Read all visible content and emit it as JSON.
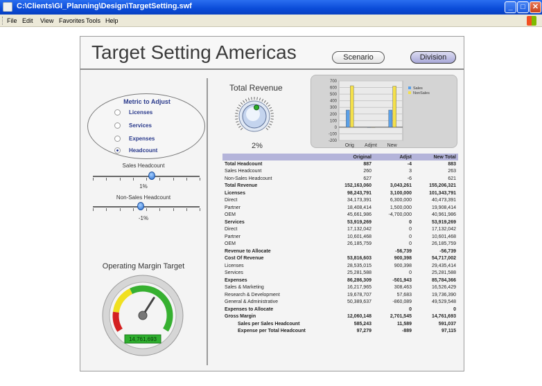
{
  "window": {
    "title": "C:\\Clients\\GI_Planning\\Design\\TargetSetting.swf",
    "menu": [
      "File",
      "Edit",
      "View",
      "Favorites",
      "Tools",
      "Help"
    ]
  },
  "app": {
    "title": "Target Setting Americas",
    "scenario_label": "Scenario",
    "division_label": "Division"
  },
  "metric": {
    "title": "Metric to Adjust",
    "options": [
      {
        "label": "Licenses",
        "selected": false
      },
      {
        "label": "Services",
        "selected": false
      },
      {
        "label": "Expenses",
        "selected": false
      },
      {
        "label": "Headcount",
        "selected": true
      }
    ]
  },
  "sliders": [
    {
      "label": "Sales Headcount",
      "value_label": "1%",
      "position": 0.55
    },
    {
      "label": "Non-Sales Headcount",
      "value_label": "-1%",
      "position": 0.45
    }
  ],
  "revenue": {
    "title": "Total Revenue",
    "percent": "2%",
    "knob_position": 0.55
  },
  "operating_margin": {
    "title": "Operating Margin Target",
    "value": "14,761,693",
    "needle_position": 0.62
  },
  "chart_data": {
    "type": "bar",
    "categories": [
      "Orig",
      "Adjmt",
      "New"
    ],
    "series": [
      {
        "name": "Sales",
        "values": [
          260,
          0,
          260
        ],
        "color": "#5aa0e8"
      },
      {
        "name": "NonSales",
        "values": [
          627,
          0,
          621
        ],
        "color": "#f4e04a"
      }
    ],
    "yticks": [
      "700",
      "600",
      "500",
      "400",
      "300",
      "200",
      "100",
      "0",
      "-100",
      "-200"
    ],
    "ylim": [
      -200,
      700
    ]
  },
  "table": {
    "headers": [
      "",
      "Original",
      "Adjst",
      "New Total"
    ],
    "rows": [
      {
        "label": "Total Headcount",
        "orig": "887",
        "adj": "-4",
        "new": "883",
        "style": "bold"
      },
      {
        "label": "Sales Headcount",
        "orig": "260",
        "adj": "3",
        "new": "263",
        "style": ""
      },
      {
        "label": "Non-Sales Headcount",
        "orig": "627",
        "adj": "-6",
        "new": "621",
        "style": ""
      },
      {
        "label": "Total Revenue",
        "orig": "152,163,060",
        "adj": "3,043,261",
        "new": "155,206,321",
        "style": "bold"
      },
      {
        "label": "Licenses",
        "orig": "98,243,791",
        "adj": "3,100,000",
        "new": "101,343,791",
        "style": "bold"
      },
      {
        "label": "Direct",
        "orig": "34,173,391",
        "adj": "6,300,000",
        "new": "40,473,391",
        "style": ""
      },
      {
        "label": "Partner",
        "orig": "18,408,414",
        "adj": "1,500,000",
        "new": "19,908,414",
        "style": ""
      },
      {
        "label": "OEM",
        "orig": "45,661,986",
        "adj": "-4,700,000",
        "new": "40,961,986",
        "style": ""
      },
      {
        "label": "Services",
        "orig": "53,919,269",
        "adj": "0",
        "new": "53,919,269",
        "style": "bold"
      },
      {
        "label": "Direct",
        "orig": "17,132,042",
        "adj": "0",
        "new": "17,132,042",
        "style": ""
      },
      {
        "label": "Partner",
        "orig": "10,601,468",
        "adj": "0",
        "new": "10,601,468",
        "style": ""
      },
      {
        "label": "OEM",
        "orig": "26,185,759",
        "adj": "0",
        "new": "26,185,759",
        "style": ""
      },
      {
        "label": "Revenue to Allocate",
        "orig": "",
        "adj": "-56,739",
        "new": "-56,739",
        "style": "bold"
      },
      {
        "label": "Cost Of Revenue",
        "orig": "53,816,603",
        "adj": "900,398",
        "new": "54,717,002",
        "style": "bold"
      },
      {
        "label": "Licenses",
        "orig": "28,535,015",
        "adj": "900,398",
        "new": "29,435,414",
        "style": ""
      },
      {
        "label": "Services",
        "orig": "25,281,588",
        "adj": "0",
        "new": "25,281,588",
        "style": ""
      },
      {
        "label": "Expenses",
        "orig": "86,286,309",
        "adj": "-501,943",
        "new": "85,784,366",
        "style": "bold"
      },
      {
        "label": "Sales & Marketing",
        "orig": "16,217,965",
        "adj": "308,463",
        "new": "16,526,429",
        "style": ""
      },
      {
        "label": "Research & Development",
        "orig": "19,678,707",
        "adj": "57,683",
        "new": "19,736,390",
        "style": ""
      },
      {
        "label": "General & Administrative",
        "orig": "50,389,637",
        "adj": "-860,089",
        "new": "49,529,548",
        "style": ""
      },
      {
        "label": "Expenses to Allocate",
        "orig": "",
        "adj": "0",
        "new": "0",
        "style": "bold"
      },
      {
        "label": "Gross Margin",
        "orig": "12,060,148",
        "adj": "2,701,545",
        "new": "14,761,693",
        "style": "bold"
      },
      {
        "label": "Sales per Sales Headcount",
        "orig": "585,243",
        "adj": "11,589",
        "new": "591,037",
        "style": "bold indent"
      },
      {
        "label": "Expense per Total Headcount",
        "orig": "97,279",
        "adj": "-889",
        "new": "97,115",
        "style": "bold indent"
      }
    ]
  },
  "colors": {
    "titlebar": "#0a4bd8",
    "accent": "#2a3a8c",
    "table_header": "#b4b4da",
    "gauge_green": "#36b030",
    "gauge_red": "#d42020",
    "gauge_yellow": "#f0e020"
  }
}
